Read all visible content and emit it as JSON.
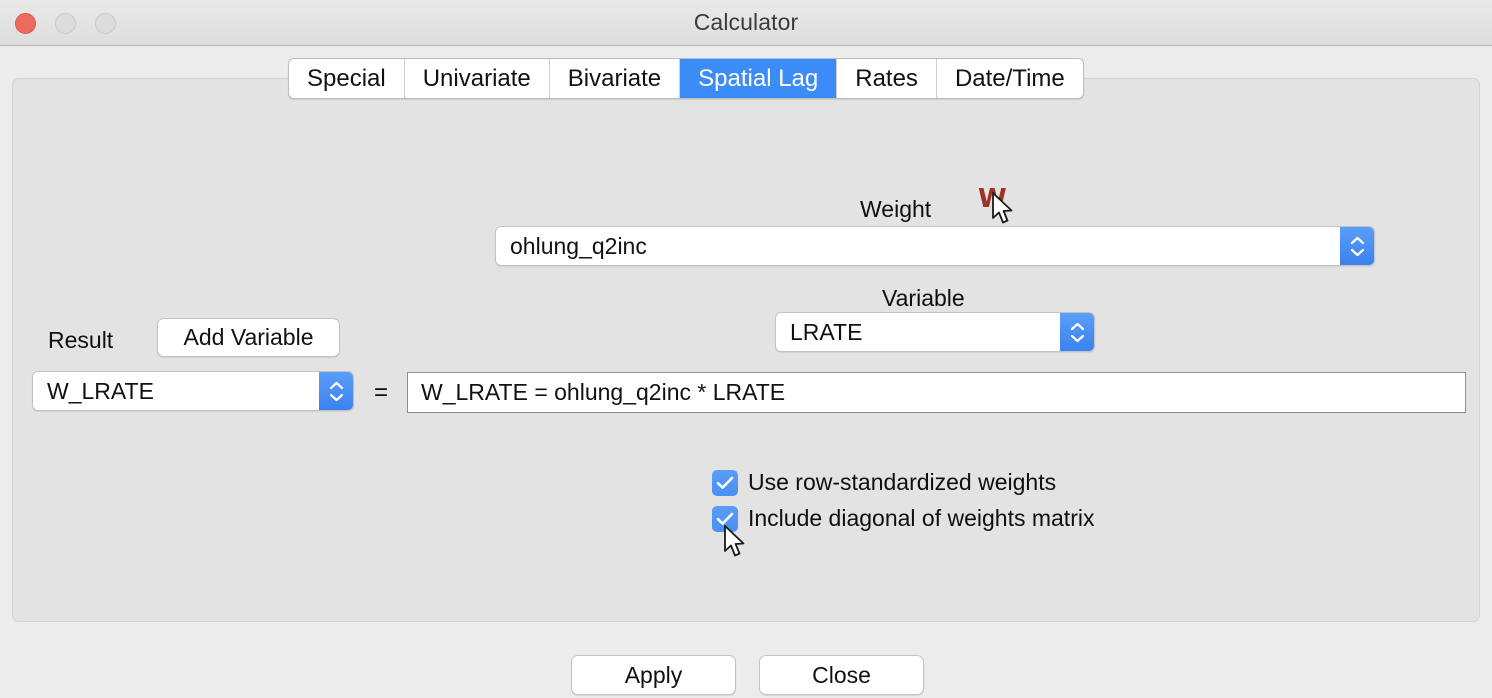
{
  "window": {
    "title": "Calculator",
    "traffic_lights": [
      {
        "name": "close",
        "color": "#ec6a5e"
      },
      {
        "name": "minimize",
        "color": "#dcdcdc"
      },
      {
        "name": "zoom",
        "color": "#dcdcdc"
      }
    ]
  },
  "tabs": [
    {
      "label": "Special",
      "active": false
    },
    {
      "label": "Univariate",
      "active": false
    },
    {
      "label": "Bivariate",
      "active": false
    },
    {
      "label": "Spatial Lag",
      "active": true
    },
    {
      "label": "Rates",
      "active": false
    },
    {
      "label": "Date/Time",
      "active": false
    }
  ],
  "active_tab": "Spatial Lag",
  "form": {
    "weight_label": "Weight",
    "weight_icon_glyph": "W",
    "weight_value": "ohlung_q2inc",
    "variable_label": "Variable",
    "variable_value": "LRATE",
    "result_label": "Result",
    "add_variable_label": "Add Variable",
    "result_value": "W_LRATE",
    "equals_sign": "=",
    "formula_value": "W_LRATE = ohlung_q2inc * LRATE"
  },
  "options": [
    {
      "label": "Use row-standardized weights",
      "checked": true
    },
    {
      "label": "Include diagonal of weights matrix",
      "checked": true
    }
  ],
  "footer": {
    "apply_label": "Apply",
    "close_label": "Close"
  },
  "colors": {
    "accent_blue": "#3b8cf6",
    "stepper_blue": "#4a8ff2",
    "checkbox_blue": "#4a8ff2",
    "close_red": "#ec6a5e",
    "w_icon_red": "#a03224",
    "panel_bg": "#e3e3e3",
    "window_bg": "#ececec"
  }
}
